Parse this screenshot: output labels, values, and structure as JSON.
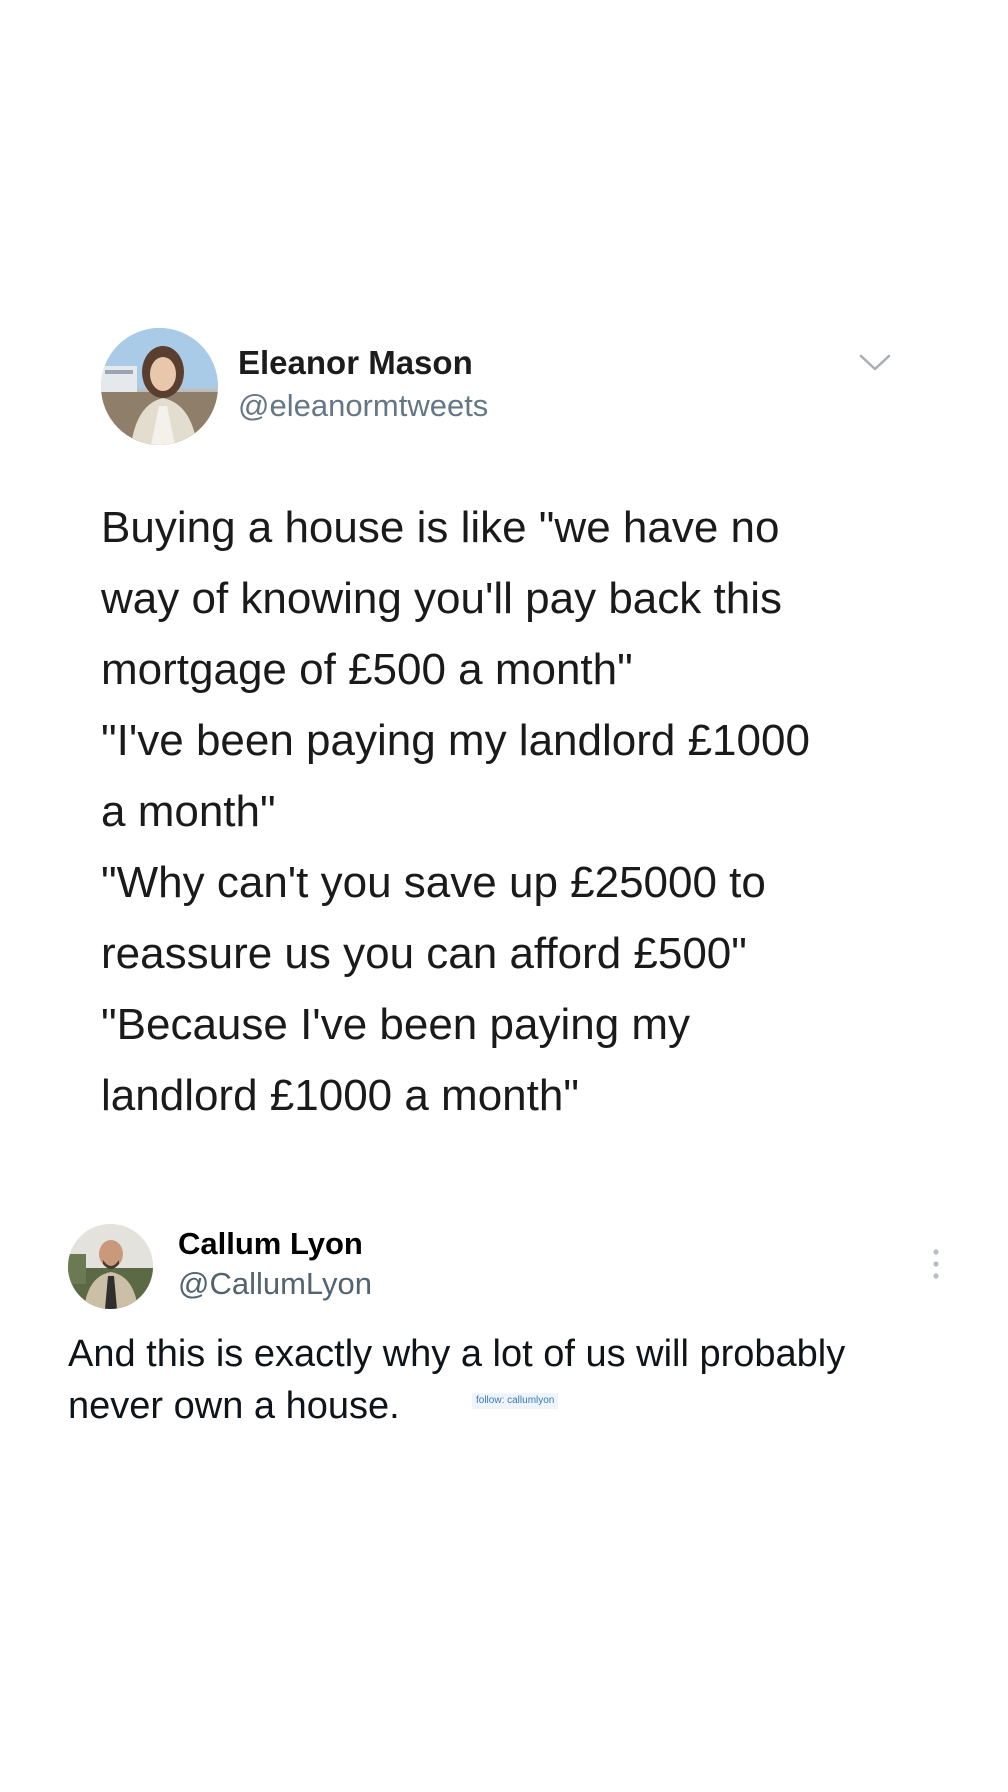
{
  "quoted_tweet": {
    "author_name": "Eleanor Mason",
    "author_handle": "@eleanormtweets",
    "avatar_icon": "profile-photo-avatar",
    "menu_icon": "chevron-down-icon",
    "text_lines": [
      "Buying a house is like \"we have no",
      "way of knowing you'll pay back this",
      "mortgage of £500 a month\"",
      "\"I've been paying my landlord £1000",
      "a month\"",
      "\"Why can't you save up £25000 to",
      "reassure us you can afford £500\"",
      "\"Because I've been paying my",
      "landlord £1000 a month\""
    ]
  },
  "main_tweet": {
    "author_name": "Callum Lyon",
    "author_handle": "@CallumLyon",
    "avatar_icon": "profile-photo-avatar",
    "menu_icon": "more-vertical-icon",
    "text_lines": [
      "And this is exactly why a lot of us will probably",
      "never own a house."
    ],
    "watermark": "follow: callumlyon"
  },
  "colors": {
    "background": "#ffffff",
    "handle_gray": "#657786",
    "watermark_blue": "#3b78b8"
  }
}
